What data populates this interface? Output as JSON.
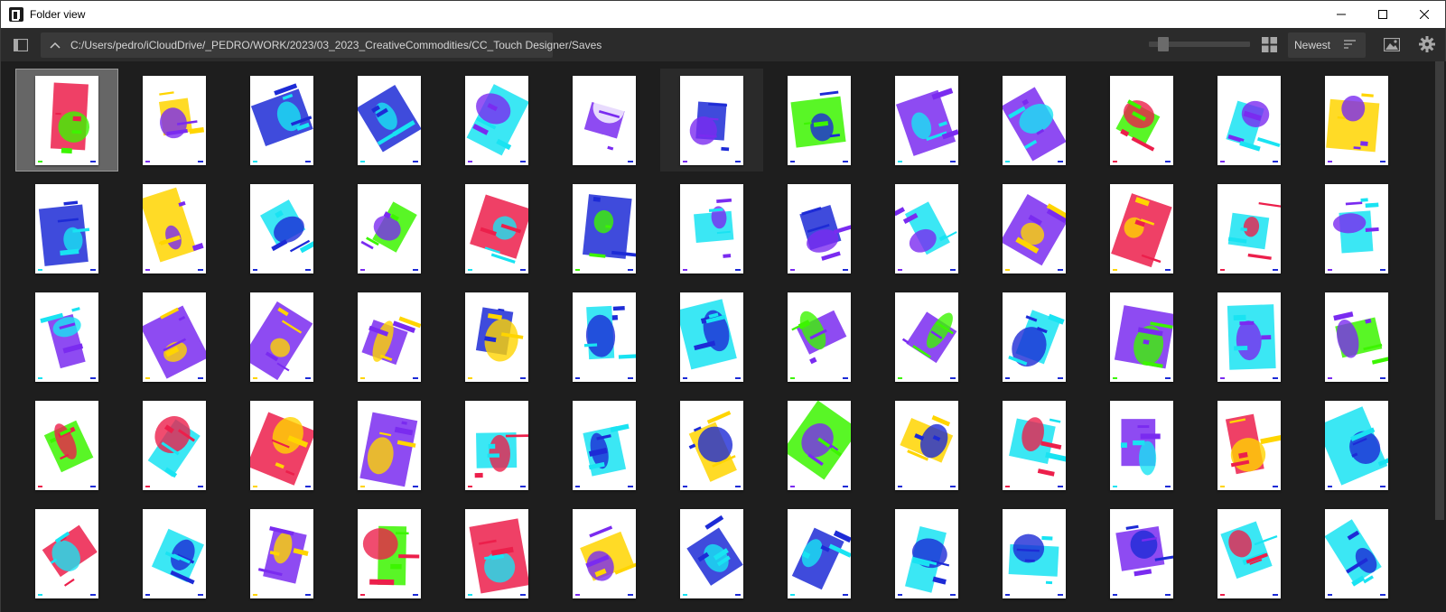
{
  "window": {
    "title": "Folder view"
  },
  "toolbar": {
    "path": "C:/Users/pedro/iCloudDrive/_PEDRO/WORK/2023/03_2023_CreativeCommodities/CC_Touch Designer/Saves",
    "sort_label": "Newest",
    "zoom_level": 0.1
  },
  "icons": {
    "sidebar": "sidebar-toggle-icon",
    "up": "chevron-up-icon",
    "grid": "grid-view-icon",
    "sort": "sort-icon",
    "image": "image-icon",
    "settings": "gear-icon"
  },
  "colors": {
    "magenta_red": "#ec1f4b",
    "yellow": "#ffd500",
    "blue": "#1d2bd6",
    "violet": "#7a2bf0",
    "cyan": "#19e3f2",
    "green": "#3cf500"
  },
  "thumbnails": [
    [
      "ec1f4b",
      "3cf500"
    ],
    [
      "ffd500",
      "7a2bf0"
    ],
    [
      "1d2bd6",
      "19e3f2"
    ],
    [
      "1d2bd6",
      "19e3f2"
    ],
    [
      "19e3f2",
      "7a2bf0"
    ],
    [
      "7a2bf0",
      "ffffff"
    ],
    [
      "1d2bd6",
      "7a2bf0"
    ],
    [
      "3cf500",
      "1d2bd6"
    ],
    [
      "7a2bf0",
      "19e3f2"
    ],
    [
      "7a2bf0",
      "19e3f2"
    ],
    [
      "3cf500",
      "ec1f4b"
    ],
    [
      "19e3f2",
      "7a2bf0"
    ],
    [
      "ffd500",
      "7a2bf0"
    ],
    [
      "1d2bd6",
      "19e3f2"
    ],
    [
      "ffd500",
      "7a2bf0"
    ],
    [
      "19e3f2",
      "1d2bd6"
    ],
    [
      "3cf500",
      "7a2bf0"
    ],
    [
      "ec1f4b",
      "19e3f2"
    ],
    [
      "1d2bd6",
      "3cf500"
    ],
    [
      "19e3f2",
      "7a2bf0"
    ],
    [
      "1d2bd6",
      "7a2bf0"
    ],
    [
      "19e3f2",
      "7a2bf0"
    ],
    [
      "7a2bf0",
      "ffd500"
    ],
    [
      "ec1f4b",
      "ffd500"
    ],
    [
      "19e3f2",
      "ec1f4b"
    ],
    [
      "19e3f2",
      "7a2bf0"
    ],
    [
      "7a2bf0",
      "19e3f2"
    ],
    [
      "7a2bf0",
      "ffd500"
    ],
    [
      "7a2bf0",
      "ffd500"
    ],
    [
      "7a2bf0",
      "ffd500"
    ],
    [
      "1d2bd6",
      "ffd500"
    ],
    [
      "19e3f2",
      "1d2bd6"
    ],
    [
      "19e3f2",
      "1d2bd6"
    ],
    [
      "7a2bf0",
      "3cf500"
    ],
    [
      "7a2bf0",
      "3cf500"
    ],
    [
      "19e3f2",
      "1d2bd6"
    ],
    [
      "7a2bf0",
      "3cf500"
    ],
    [
      "19e3f2",
      "7a2bf0"
    ],
    [
      "3cf500",
      "7a2bf0"
    ],
    [
      "3cf500",
      "ec1f4b"
    ],
    [
      "19e3f2",
      "ec1f4b"
    ],
    [
      "ec1f4b",
      "ffd500"
    ],
    [
      "7a2bf0",
      "ffd500"
    ],
    [
      "19e3f2",
      "ec1f4b"
    ],
    [
      "19e3f2",
      "1d2bd6"
    ],
    [
      "ffd500",
      "1d2bd6"
    ],
    [
      "3cf500",
      "7a2bf0"
    ],
    [
      "ffd500",
      "1d2bd6"
    ],
    [
      "19e3f2",
      "ec1f4b"
    ],
    [
      "7a2bf0",
      "19e3f2"
    ],
    [
      "ec1f4b",
      "ffd500"
    ],
    [
      "19e3f2",
      "1d2bd6"
    ],
    [
      "ec1f4b",
      "19e3f2"
    ],
    [
      "19e3f2",
      "1d2bd6"
    ],
    [
      "7a2bf0",
      "ffd500"
    ],
    [
      "3cf500",
      "ec1f4b"
    ],
    [
      "ec1f4b",
      "19e3f2"
    ],
    [
      "ffd500",
      "7a2bf0"
    ],
    [
      "1d2bd6",
      "19e3f2"
    ],
    [
      "1d2bd6",
      "19e3f2"
    ],
    [
      "19e3f2",
      "1d2bd6"
    ],
    [
      "19e3f2",
      "1d2bd6"
    ],
    [
      "7a2bf0",
      "1d2bd6"
    ],
    [
      "19e3f2",
      "ec1f4b"
    ],
    [
      "19e3f2",
      "1d2bd6"
    ]
  ]
}
